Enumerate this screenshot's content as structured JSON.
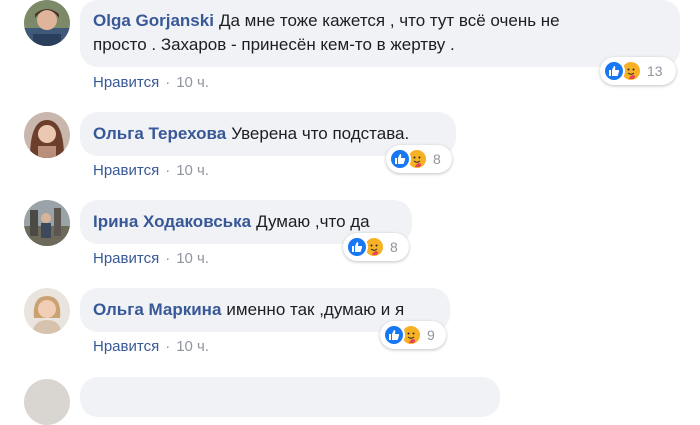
{
  "comments": [
    {
      "author": "Olga Gorjanski",
      "text": "Да мне тоже кажется , что тут всё очень не просто . Захаров - принесён кем-то в жертву .",
      "text_line1": "Да мне тоже кажется , что тут всё очень не",
      "text_line2": "просто . Захаров - принесён кем-то в жертву .",
      "like_label": "Нравится",
      "separator": "·",
      "time": "10 ч.",
      "reaction_count": "13"
    },
    {
      "author": "Ольга Терехова",
      "text": "Уверена что подстава.",
      "like_label": "Нравится",
      "separator": "·",
      "time": "10 ч.",
      "reaction_count": "8"
    },
    {
      "author": "Ірина Ходаковська",
      "text": "Думаю ,что да",
      "like_label": "Нравится",
      "separator": "·",
      "time": "10 ч.",
      "reaction_count": "8"
    },
    {
      "author": "Ольга Маркина",
      "text": "именно так ,думаю и я",
      "like_label": "Нравится",
      "separator": "·",
      "time": "10 ч.",
      "reaction_count": "9"
    }
  ],
  "icons": {
    "like": "thumbs-up-icon",
    "care": "care-hug-icon"
  },
  "colors": {
    "author": "#385898",
    "bubble": "#f0f2f5",
    "meta": "#90949c",
    "like_reaction": "#1877f2",
    "care_reaction": "#f7b125"
  }
}
